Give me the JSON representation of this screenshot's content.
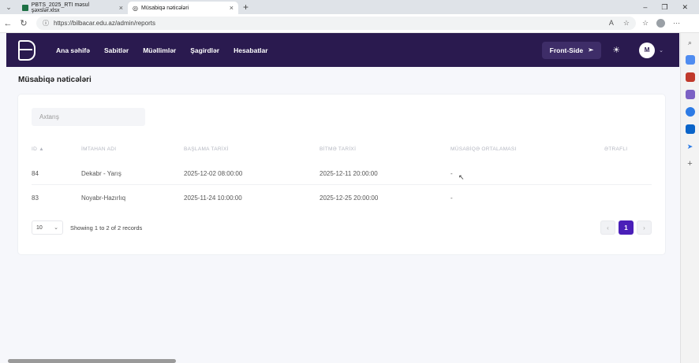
{
  "browser": {
    "tabs": [
      {
        "title": "PBTS_2025_RTI məsul şəxslər.xlsx",
        "active": false
      },
      {
        "title": "Müsabiqə nəticələri",
        "active": true
      }
    ],
    "url": "https://bilbacar.edu.az/admin/reports"
  },
  "nav": {
    "menu": [
      "Ana səhifə",
      "Sabitlər",
      "Müəllimlər",
      "Şagirdlər",
      "Hesabatlar"
    ],
    "front_side_label": "Front-Side",
    "avatar_initial": "M"
  },
  "page": {
    "title": "Müsabiqə nəticələri"
  },
  "search": {
    "placeholder": "Axtarış"
  },
  "table": {
    "headers": [
      "ID ▲",
      "İMTAHAN ADI",
      "BAŞLAMA TARİXİ",
      "BİTMƏ TARİXİ",
      "MÜSABİQƏ ORTALAMASI",
      "ƏTRAFLI"
    ],
    "rows": [
      {
        "id": "84",
        "name": "Dekabr - Yarış",
        "start": "2025-12-02 08:00:00",
        "end": "2025-12-11 20:00:00",
        "average": "-",
        "details": ""
      },
      {
        "id": "83",
        "name": "Noyabr-Hazırlıq",
        "start": "2025-11-24 10:00:00",
        "end": "2025-12-25 20:00:00",
        "average": "-",
        "details": ""
      }
    ]
  },
  "pagination": {
    "page_size": "10",
    "records_text": "Showing 1 to 2 of 2 records",
    "prev": "‹",
    "current": "1",
    "next": "›"
  },
  "colors": {
    "nav_bg": "#2a1a4f",
    "accent": "#4a1fb8"
  }
}
